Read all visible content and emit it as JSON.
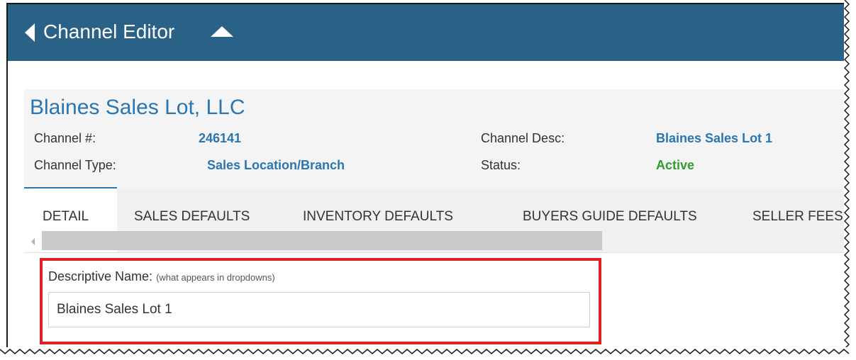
{
  "header": {
    "title": "Channel Editor"
  },
  "channel": {
    "name": "Blaines Sales Lot, LLC",
    "fields": [
      {
        "label": "Channel #:",
        "value": "246141"
      },
      {
        "label": "Channel Type:",
        "value": "Sales Location/Branch"
      },
      {
        "label": "Channel Desc:",
        "value": "Blaines Sales Lot 1"
      },
      {
        "label": "Status:",
        "value": "Active"
      }
    ]
  },
  "tabs": [
    {
      "label": "DETAIL",
      "active": true
    },
    {
      "label": "SALES DEFAULTS",
      "active": false
    },
    {
      "label": "INVENTORY DEFAULTS",
      "active": false
    },
    {
      "label": "BUYERS GUIDE DEFAULTS",
      "active": false
    },
    {
      "label": "SELLER FEES",
      "active": false
    }
  ],
  "form": {
    "descriptive_name_label": "Descriptive Name:",
    "descriptive_name_hint": "(what appears in dropdowns)",
    "descriptive_name_value": "Blaines Sales Lot 1"
  },
  "colors": {
    "header_bg": "#2a6287",
    "link_blue": "#2a76b1",
    "status_active": "#2e9e2e",
    "highlight_red": "#e02020"
  },
  "icons": {
    "back": "triangle-left",
    "collapse": "triangle-up"
  }
}
